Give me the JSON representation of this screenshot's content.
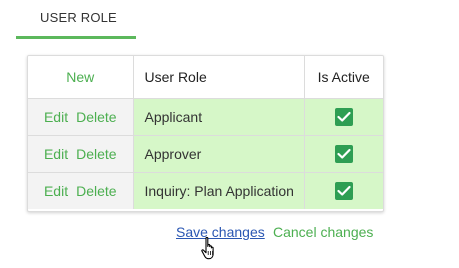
{
  "tab": {
    "label": "USER ROLE",
    "accent": "#5cb85c"
  },
  "grid": {
    "headers": {
      "new": "New",
      "role": "User Role",
      "active": "Is Active"
    },
    "rows": [
      {
        "edit": "Edit",
        "delete": "Delete",
        "role": "Applicant",
        "active": true
      },
      {
        "edit": "Edit",
        "delete": "Delete",
        "role": "Approver",
        "active": true
      },
      {
        "edit": "Edit",
        "delete": "Delete",
        "role": "Inquiry: Plan Application",
        "active": true
      }
    ],
    "row_color": "#d6f7c8",
    "checkbox_color": "#2e9e53"
  },
  "actions": {
    "save": "Save changes",
    "cancel": "Cancel changes"
  }
}
